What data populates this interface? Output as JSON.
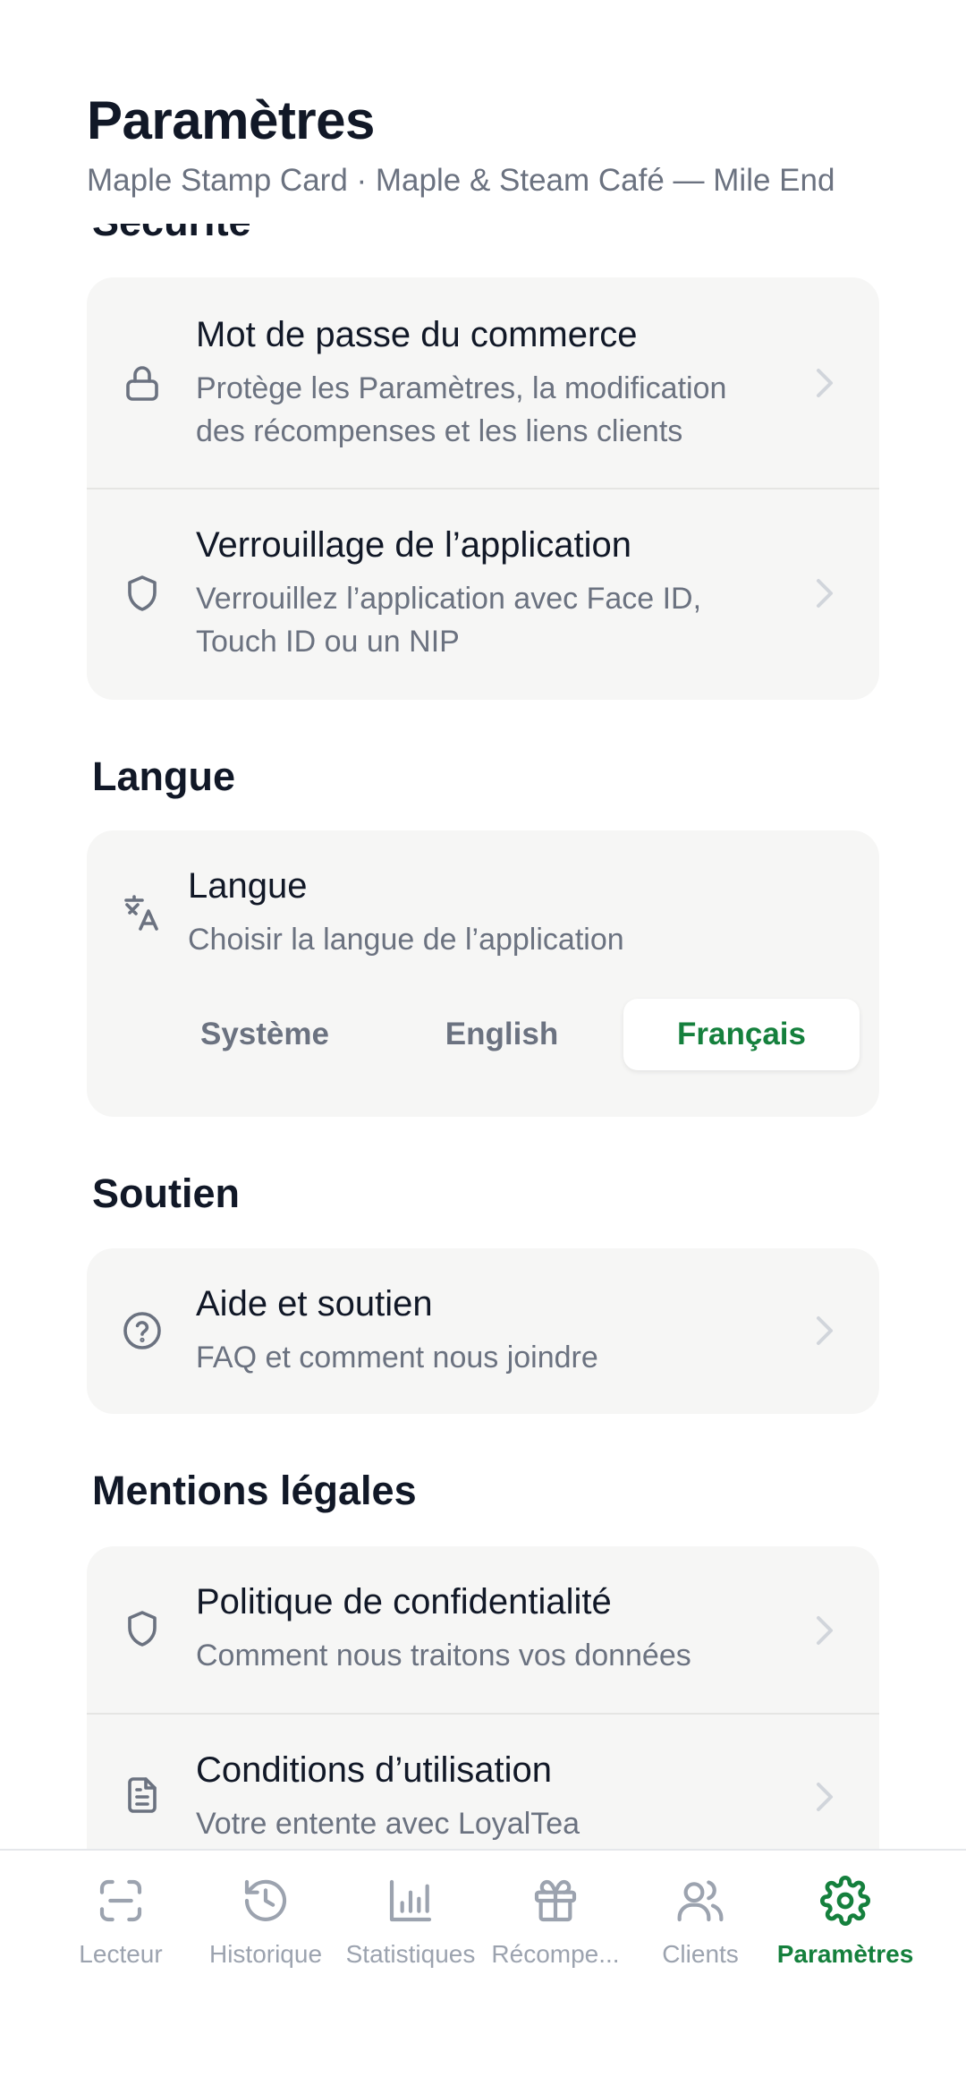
{
  "header": {
    "title": "Paramètres",
    "subtitle": "Maple Stamp Card · Maple & Steam Café — Mile End"
  },
  "sections": {
    "security": {
      "title": "Sécurité",
      "items": [
        {
          "title": "Mot de passe du commerce",
          "description": "Protège les Paramètres, la modification des récompenses et les liens clients",
          "icon": "lock-icon"
        },
        {
          "title": "Verrouillage de l’application",
          "description": "Verrouillez l’application avec Face ID, Touch ID ou un NIP",
          "icon": "shield-icon"
        }
      ]
    },
    "language": {
      "title": "Langue",
      "item": {
        "title": "Langue",
        "description": "Choisir la langue de l’application",
        "icon": "translate-icon"
      },
      "options": [
        "Système",
        "English",
        "Français"
      ],
      "selected": "Français"
    },
    "support": {
      "title": "Soutien",
      "items": [
        {
          "title": "Aide et soutien",
          "description": "FAQ et comment nous joindre",
          "icon": "help-circle-icon"
        }
      ]
    },
    "legal": {
      "title": "Mentions légales",
      "items": [
        {
          "title": "Politique de confidentialité",
          "description": "Comment nous traitons vos données",
          "icon": "shield-icon"
        },
        {
          "title": "Conditions d’utilisation",
          "description": "Votre entente avec LoyalTea",
          "icon": "document-icon"
        }
      ]
    }
  },
  "tabbar": {
    "items": [
      {
        "label": "Lecteur",
        "icon": "scan-icon"
      },
      {
        "label": "Historique",
        "icon": "history-icon"
      },
      {
        "label": "Statistiques",
        "icon": "bar-chart-icon"
      },
      {
        "label": "Récompe...",
        "icon": "gift-icon"
      },
      {
        "label": "Clients",
        "icon": "users-icon"
      },
      {
        "label": "Paramètres",
        "icon": "gear-icon"
      }
    ],
    "active": "Paramètres"
  },
  "colors": {
    "accent": "#15803d",
    "card_bg": "#f6f6f5",
    "muted_text": "#6b7280",
    "inactive_tab": "#9ca3af"
  }
}
